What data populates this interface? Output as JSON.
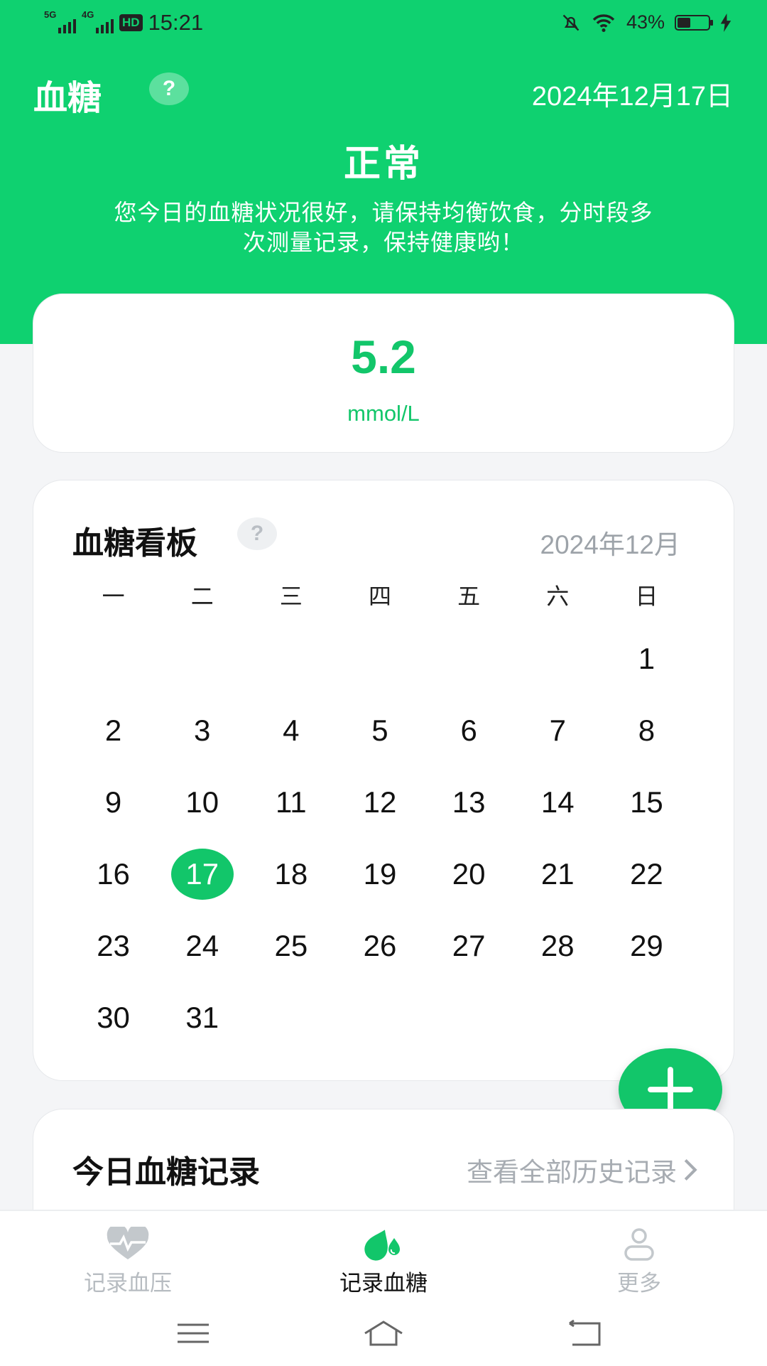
{
  "status_bar": {
    "network1": "5G",
    "network2": "4G",
    "hd_label": "HD",
    "time": "15:21",
    "battery": "43%",
    "battery_level": 0.43
  },
  "header": {
    "title": "血糖",
    "help": "?",
    "date": "2024年12月17日",
    "status": "正常",
    "advice": "您今日的血糖状况很好，请保持均衡饮食，分时段多次测量记录，保持健康哟！"
  },
  "reading": {
    "value": "5.2",
    "unit": "mmol/L"
  },
  "calendar": {
    "title": "血糖看板",
    "help": "?",
    "month": "2024年12月",
    "weekdays": [
      "一",
      "二",
      "三",
      "四",
      "五",
      "六",
      "日"
    ],
    "leading_blanks": 6,
    "days": [
      "1",
      "2",
      "3",
      "4",
      "5",
      "6",
      "7",
      "8",
      "9",
      "10",
      "11",
      "12",
      "13",
      "14",
      "15",
      "16",
      "17",
      "18",
      "19",
      "20",
      "21",
      "22",
      "23",
      "24",
      "25",
      "26",
      "27",
      "28",
      "29",
      "30",
      "31"
    ],
    "selected_day": "17"
  },
  "records": {
    "title": "今日血糖记录",
    "link": "查看全部历史记录"
  },
  "bottom_nav": {
    "items": [
      {
        "label": "记录血压",
        "icon": "heart-pulse-icon"
      },
      {
        "label": "记录血糖",
        "icon": "blood-drop-icon"
      },
      {
        "label": "更多",
        "icon": "user-icon"
      }
    ]
  },
  "colors": {
    "brand_green": "#0fd170",
    "accent_green": "#12c66a",
    "muted_gray": "#a7acb2"
  }
}
